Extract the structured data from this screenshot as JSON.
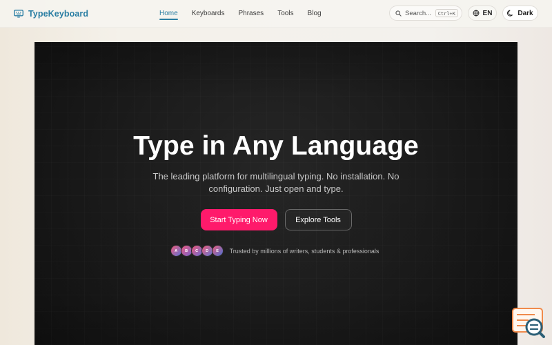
{
  "brand": {
    "name": "TypeKeyboard",
    "icon": "keyboard-icon",
    "color": "#2a7ea3"
  },
  "nav": {
    "items": [
      {
        "label": "Home",
        "active": true
      },
      {
        "label": "Keyboards",
        "active": false
      },
      {
        "label": "Phrases",
        "active": false
      },
      {
        "label": "Tools",
        "active": false
      },
      {
        "label": "Blog",
        "active": false
      }
    ]
  },
  "search": {
    "placeholder": "Search...",
    "shortcut": "Ctrl+K",
    "icon": "search-icon"
  },
  "language_button": {
    "label": "EN",
    "icon": "globe-icon"
  },
  "theme_button": {
    "label": "Dark",
    "icon": "moon-icon"
  },
  "hero": {
    "title": "Type in Any Language",
    "subtitle": "The leading platform for multilingual typing. No installation. No configuration. Just open and type.",
    "primary_button": "Start Typing Now",
    "secondary_button": "Explore Tools",
    "trust_avatars": [
      "A",
      "B",
      "C",
      "D",
      "E"
    ],
    "trust_text": "Trusted by millions of writers, students & professionals",
    "colors": {
      "background": "#1d1d1d",
      "primary": "#ff1a6b",
      "text": "#ffffff"
    }
  },
  "help_widget": {
    "icon": "help-search-icon",
    "accent": "#f08a4b",
    "icon_color": "#2b5f76"
  }
}
